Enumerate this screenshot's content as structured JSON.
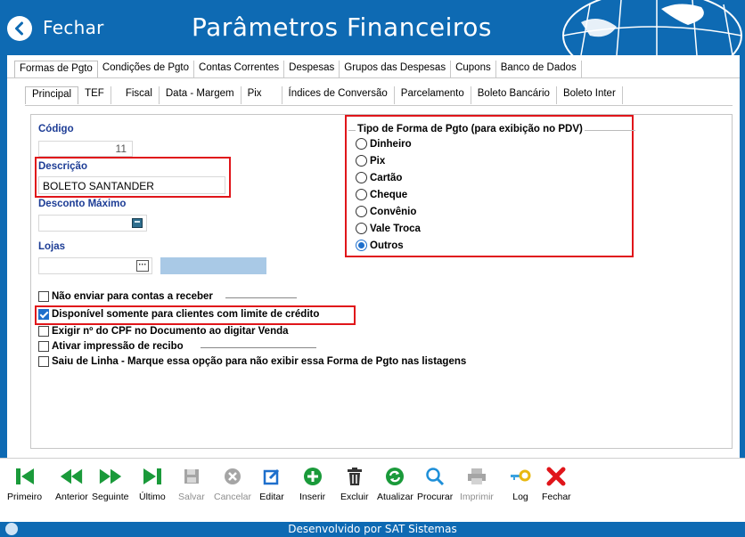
{
  "header": {
    "back_label": "Fechar",
    "title": "Parâmetros Financeiros"
  },
  "tabs_main": [
    "Formas de Pgto",
    "Condições de Pgto",
    "Contas Correntes",
    "Despesas",
    "Grupos das Despesas",
    "Cupons",
    "Banco de Dados"
  ],
  "tabs_sub": [
    "Principal",
    "TEF",
    "Fiscal",
    "Data - Margem",
    "Pix",
    "Índices de Conversão",
    "Parcelamento",
    "Boleto Bancário",
    "Boleto Inter"
  ],
  "form": {
    "codigo_label": "Código",
    "codigo_value": "11",
    "descricao_label": "Descrição",
    "descricao_value": "BOLETO SANTANDER",
    "desconto_label": "Desconto Máximo",
    "lojas_label": "Lojas",
    "lojas_button": "···"
  },
  "checkboxes": [
    {
      "label": "Não enviar para contas a receber",
      "checked": false
    },
    {
      "label": "Disponível somente para clientes com limite de crédito",
      "checked": true
    },
    {
      "label": "Exigir nº do CPF no Documento ao digitar Venda",
      "checked": false
    },
    {
      "label": "Ativar impressão de recibo",
      "checked": false
    },
    {
      "label": "Saiu de Linha - Marque essa opção para não exibir essa Forma de Pgto nas listagens",
      "checked": false
    }
  ],
  "tipo_group": {
    "title": "Tipo de Forma de Pgto (para exibição no PDV)",
    "options": [
      "Dinheiro",
      "Pix",
      "Cartão",
      "Cheque",
      "Convênio",
      "Vale Troca",
      "Outros"
    ],
    "selected": "Outros"
  },
  "toolbar": {
    "primeiro": "Primeiro",
    "anterior": "Anterior",
    "seguinte": "Seguinte",
    "ultimo": "Último",
    "salvar": "Salvar",
    "cancelar": "Cancelar",
    "editar": "Editar",
    "inserir": "Inserir",
    "excluir": "Excluir",
    "atualizar": "Atualizar",
    "procurar": "Procurar",
    "imprimir": "Imprimir",
    "log": "Log",
    "fechar": "Fechar"
  },
  "footer": {
    "text": "Desenvolvido por SAT Sistemas"
  },
  "colors": {
    "brand": "#0e6ab3",
    "label_blue": "#1c3c95",
    "highlight_red": "#e0151a",
    "nav_green": "#1a9a3a",
    "close_red": "#e0151a"
  }
}
